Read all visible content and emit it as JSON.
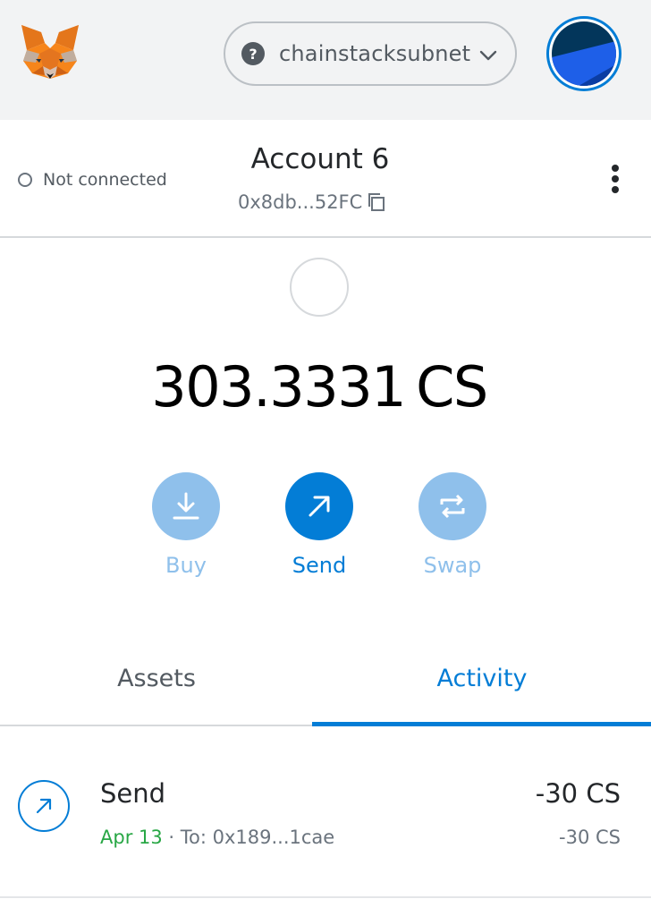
{
  "header": {
    "network": {
      "name": "chainstacksubnet",
      "help_glyph": "?",
      "icon": "chevron-down-icon"
    },
    "logo_icon": "metamask-fox-icon",
    "avatar_icon": "account-identicon"
  },
  "account": {
    "connection_status": "Not connected",
    "name": "Account 6",
    "address": "0x8db...52FC",
    "copy_icon": "copy-icon",
    "menu_icon": "kebab-menu-icon"
  },
  "balance": {
    "amount": "303.3331",
    "symbol": "CS"
  },
  "actions": [
    {
      "label": "Buy",
      "icon": "download-icon"
    },
    {
      "label": "Send",
      "icon": "arrow-up-right-icon"
    },
    {
      "label": "Swap",
      "icon": "swap-arrows-icon"
    }
  ],
  "tabs": [
    {
      "label": "Assets",
      "active": false
    },
    {
      "label": "Activity",
      "active": true
    }
  ],
  "activity": [
    {
      "title": "Send",
      "date": "Apr 13",
      "separator": " · ",
      "to": "To: 0x189...1cae",
      "amount": "-30 CS",
      "secondary_amount": "-30 CS",
      "icon": "arrow-up-right-icon"
    }
  ],
  "colors": {
    "primary": "#037dd6",
    "primary_faded": "#8fc0eb",
    "success": "#28a745",
    "header_bg": "#f2f3f4"
  }
}
